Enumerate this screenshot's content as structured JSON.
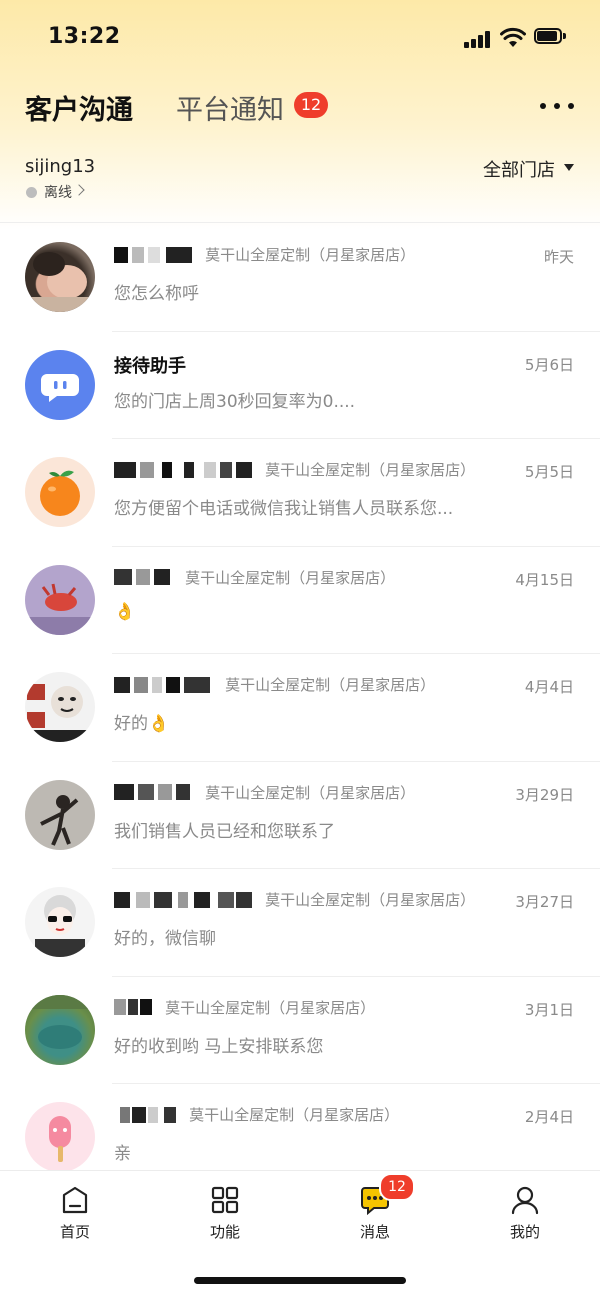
{
  "status_bar": {
    "time": "13:22"
  },
  "header": {
    "tabs": [
      {
        "label": "客户沟通",
        "active": true
      },
      {
        "label": "平台通知",
        "badge": "12"
      }
    ],
    "more_icon": "more-horizontal-icon"
  },
  "account": {
    "name": "sijing13",
    "status": "离线",
    "store_filter": "全部门店"
  },
  "conversations": [
    {
      "store": "莫干山全屋定制（月星家居店）",
      "time": "昨天",
      "preview": "您怎么称呼"
    },
    {
      "name": "接待助手",
      "store": "",
      "time": "5月6日",
      "preview": "您的门店上周30秒回复率为0...."
    },
    {
      "store": "莫干山全屋定制（月星家居店）",
      "time": "5月5日",
      "preview": "您方便留个电话或微信我让销售人员联系您..."
    },
    {
      "store": "莫干山全屋定制（月星家居店）",
      "time": "4月15日",
      "preview": "👌"
    },
    {
      "store": "莫干山全屋定制（月星家居店）",
      "time": "4月4日",
      "preview": "好的👌"
    },
    {
      "store": "莫干山全屋定制（月星家居店）",
      "time": "3月29日",
      "preview": "我们销售人员已经和您联系了"
    },
    {
      "store": "莫干山全屋定制（月星家居店）",
      "time": "3月27日",
      "preview": "好的，微信聊"
    },
    {
      "store": "莫干山全屋定制（月星家居店）",
      "time": "3月1日",
      "preview": "好的收到哟 马上安排联系您"
    },
    {
      "store": "莫干山全屋定制（月星家居店）",
      "time": "2月4日",
      "preview": "亲"
    }
  ],
  "bottom_nav": {
    "items": [
      {
        "label": "首页",
        "icon": "home-icon"
      },
      {
        "label": "功能",
        "icon": "grid-icon"
      },
      {
        "label": "消息",
        "icon": "message-icon",
        "badge": "12",
        "active": true
      },
      {
        "label": "我的",
        "icon": "profile-icon"
      }
    ]
  },
  "colors": {
    "accent": "#f5c400",
    "badge": "#ef3d2b",
    "header_bg": "#fde9a8"
  }
}
